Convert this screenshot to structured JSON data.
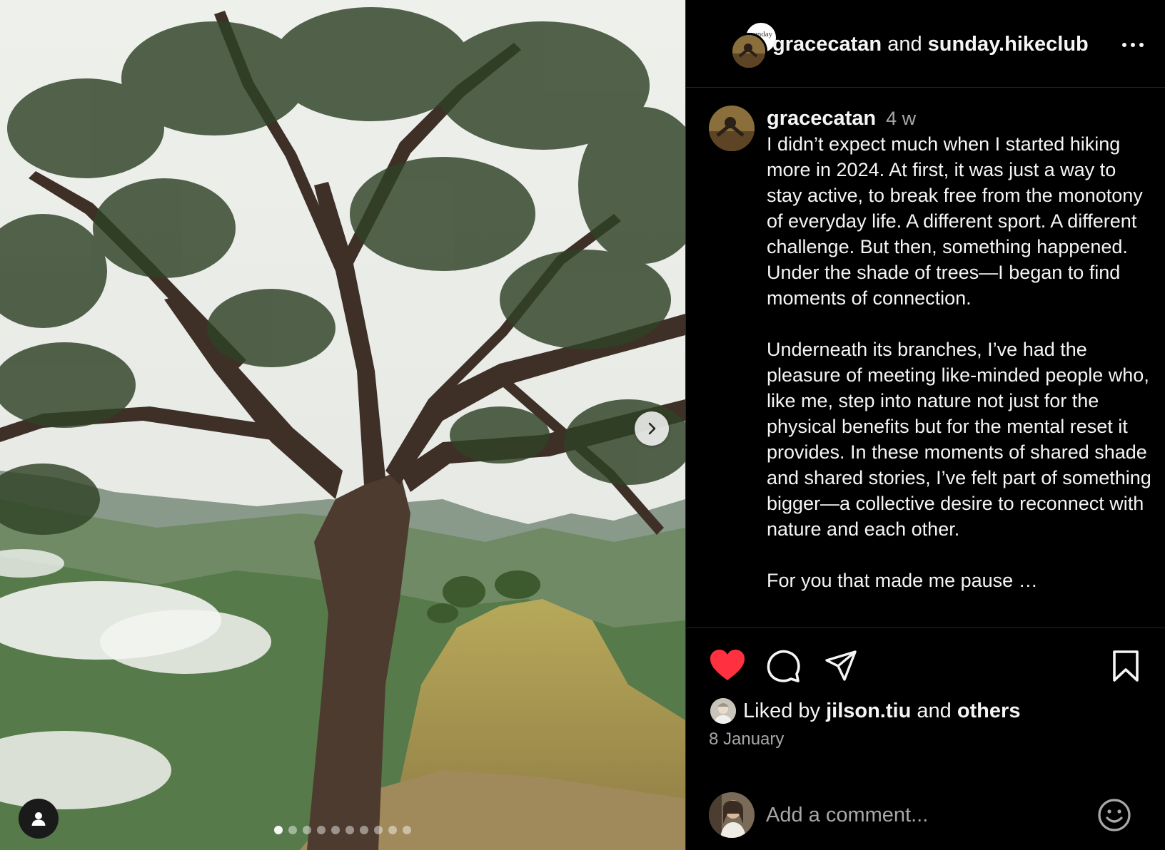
{
  "post": {
    "photo_alt": "",
    "slides_count": 10,
    "active_slide": 1,
    "icons": {
      "next": "chevron-right-icon",
      "tagged_users": "user-icon"
    }
  },
  "header": {
    "author": "gracecatan",
    "joiner": "and",
    "collaborator": "sunday.hikeclub",
    "collaborator_avatar_text": "sunday hike club",
    "more_icon": "more-horizontal-icon"
  },
  "caption": {
    "username": "gracecatan",
    "time_ago": "4 w",
    "text": "I didn’t expect much when I started hiking more in 2024. At first, it was just a way to stay active, to break free from the monotony of everyday life. A different sport. A different challenge. But then, something happened. Under the shade of trees—I began to find moments of connection.\n\nUnderneath its branches, I’ve had the pleasure of meeting like-minded people who, like me, step into nature not just for the physical benefits but for the mental reset it provides. In these moments of shared shade and shared stories, I’ve felt part of something bigger—a collective desire to reconnect with nature and each other.\n\nFor you that made me pause …"
  },
  "actions": {
    "liked": true,
    "icons": [
      "heart-icon",
      "comment-icon",
      "share-icon",
      "bookmark-icon"
    ],
    "like_color": "#ff3040"
  },
  "likes": {
    "prefix": "Liked by",
    "user": "jilson.tiu",
    "joiner": "and",
    "others": "others"
  },
  "date": "8 January",
  "comment": {
    "placeholder": "Add a comment...",
    "emoji_icon": "smiley-icon"
  },
  "colors": {
    "background": "#000000",
    "text": "#f5f5f5",
    "muted": "#a8a8a8",
    "divider": "#262626"
  }
}
